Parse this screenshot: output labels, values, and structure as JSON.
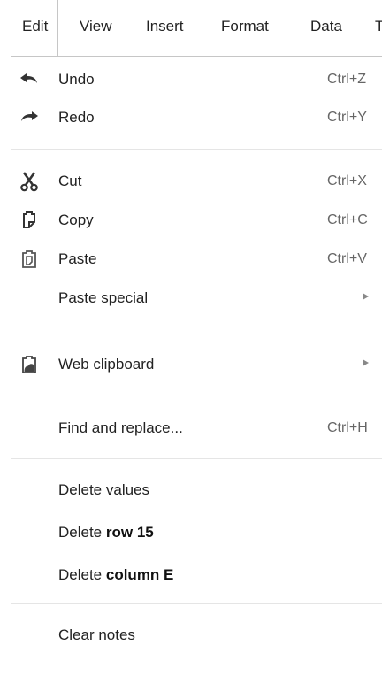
{
  "menubar": {
    "items": [
      "Edit",
      "View",
      "Insert",
      "Format",
      "Data",
      "T"
    ]
  },
  "menu": {
    "undo": {
      "label": "Undo",
      "shortcut": "Ctrl+Z",
      "icon": "undo-icon"
    },
    "redo": {
      "label": "Redo",
      "shortcut": "Ctrl+Y",
      "icon": "redo-icon"
    },
    "cut": {
      "label": "Cut",
      "shortcut": "Ctrl+X",
      "icon": "scissors-icon"
    },
    "copy": {
      "label": "Copy",
      "shortcut": "Ctrl+C",
      "icon": "copy-icon"
    },
    "paste": {
      "label": "Paste",
      "shortcut": "Ctrl+V",
      "icon": "paste-icon"
    },
    "paste_special": {
      "label": "Paste special"
    },
    "web_clipboard": {
      "label": "Web clipboard",
      "icon": "clipboard-icon"
    },
    "find_replace": {
      "label": "Find and replace...",
      "shortcut": "Ctrl+H"
    },
    "delete_values": {
      "label": "Delete values"
    },
    "delete_row": {
      "prefix": "Delete ",
      "bold": "row 15"
    },
    "delete_column": {
      "prefix": "Delete ",
      "bold": "column E"
    },
    "clear_notes": {
      "label": "Clear notes"
    }
  },
  "colors": {
    "text": "#222222",
    "shortcut": "#666666",
    "border": "#c6c6c6",
    "separator": "#e5e5e5"
  }
}
